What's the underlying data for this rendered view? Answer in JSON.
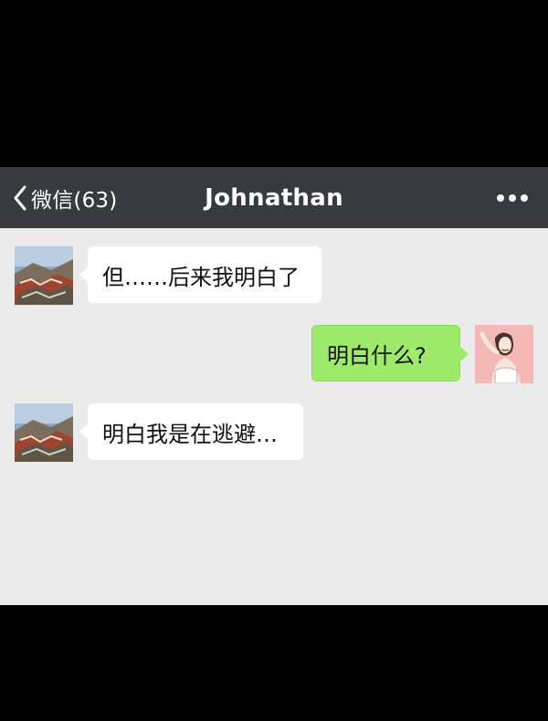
{
  "navbar": {
    "back_label": "微信(63)",
    "title": "Johnathan"
  },
  "messages": [
    {
      "direction": "incoming",
      "text": "但……后来我明白了"
    },
    {
      "direction": "outgoing",
      "text": "明白什么?"
    },
    {
      "direction": "incoming",
      "text": "明白我是在逃避…"
    }
  ],
  "colors": {
    "navbar_bg": "#393a3f",
    "chat_bg": "#ebebeb",
    "outgoing_bubble": "#9eea6a",
    "incoming_bubble": "#ffffff"
  },
  "icons": {
    "back": "chevron-left-icon",
    "more": "more-dots-icon"
  }
}
